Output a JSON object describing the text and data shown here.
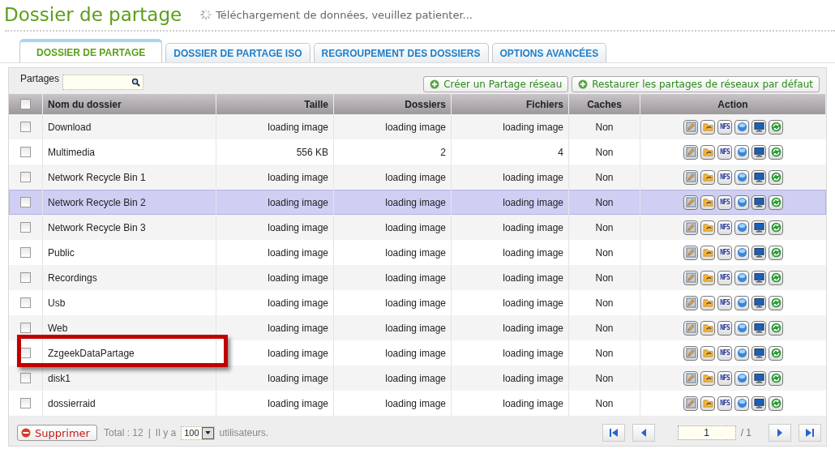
{
  "page_title": "Dossier de partage",
  "loading_status": "Téléchargement de données, veuillez patienter...",
  "tabs": [
    {
      "label": "DOSSIER DE PARTAGE",
      "selected": true
    },
    {
      "label": "DOSSIER DE PARTAGE ISO",
      "selected": false
    },
    {
      "label": "REGROUPEMENT DES DOSSIERS",
      "selected": false
    },
    {
      "label": "OPTIONS AVANCÉES",
      "selected": false
    }
  ],
  "toolbar": {
    "search_label": "Partages",
    "buttons": [
      "Créer un Partage réseau",
      "Restaurer les partages de réseaux par défaut"
    ]
  },
  "table": {
    "select_all_checked": false,
    "columns": [
      "Nom du dossier",
      "Taille",
      "Dossiers",
      "Fichiers",
      "Caches",
      "Action"
    ],
    "rows": [
      {
        "name": "Download",
        "size": "loading image",
        "folders": "loading image",
        "files": "loading image",
        "caches": "Non",
        "nfs": "NFS",
        "checked": false,
        "highlighted": false,
        "annotated": false
      },
      {
        "name": "Multimedia",
        "size": "556 KB",
        "folders": "2",
        "files": "4",
        "caches": "Non",
        "nfs": "NFS",
        "checked": false,
        "highlighted": false,
        "annotated": false
      },
      {
        "name": "Network Recycle Bin 1",
        "size": "loading image",
        "folders": "loading image",
        "files": "loading image",
        "caches": "Non",
        "nfs": "NFS",
        "checked": false,
        "highlighted": false,
        "annotated": false
      },
      {
        "name": "Network Recycle Bin 2",
        "size": "loading image",
        "folders": "loading image",
        "files": "loading image",
        "caches": "Non",
        "nfs": "NFS",
        "checked": false,
        "highlighted": true,
        "annotated": false
      },
      {
        "name": "Network Recycle Bin 3",
        "size": "loading image",
        "folders": "loading image",
        "files": "loading image",
        "caches": "Non",
        "nfs": "NFS",
        "checked": false,
        "highlighted": false,
        "annotated": false
      },
      {
        "name": "Public",
        "size": "loading image",
        "folders": "loading image",
        "files": "loading image",
        "caches": "Non",
        "nfs": "NFS",
        "checked": false,
        "highlighted": false,
        "annotated": false
      },
      {
        "name": "Recordings",
        "size": "loading image",
        "folders": "loading image",
        "files": "loading image",
        "caches": "Non",
        "nfs": "NFS",
        "checked": false,
        "highlighted": false,
        "annotated": false
      },
      {
        "name": "Usb",
        "size": "loading image",
        "folders": "loading image",
        "files": "loading image",
        "caches": "Non",
        "nfs": "NFS",
        "checked": false,
        "highlighted": false,
        "annotated": false
      },
      {
        "name": "Web",
        "size": "loading image",
        "folders": "loading image",
        "files": "loading image",
        "caches": "Non",
        "nfs": "NFS",
        "checked": false,
        "highlighted": false,
        "annotated": false
      },
      {
        "name": "ZzgeekDataPartage",
        "size": "loading image",
        "folders": "loading image",
        "files": "loading image",
        "caches": "Non",
        "nfs": "NFS",
        "checked": false,
        "highlighted": false,
        "annotated": true
      },
      {
        "name": "disk1",
        "size": "loading image",
        "folders": "loading image",
        "files": "loading image",
        "caches": "Non",
        "nfs": "NFS",
        "checked": false,
        "highlighted": false,
        "annotated": false
      },
      {
        "name": "dossierraid",
        "size": "loading image",
        "folders": "loading image",
        "files": "loading image",
        "caches": "Non",
        "nfs": "NFS",
        "checked": false,
        "highlighted": false,
        "annotated": false
      }
    ]
  },
  "footer": {
    "delete_button": "Supprimer",
    "total": "Total : 12",
    "separator": "|",
    "per_page_prefix": "Il y a",
    "per_page": "100",
    "per_page_suffix": "utilisateurs.",
    "page": "1",
    "page_total": "/ 1"
  }
}
